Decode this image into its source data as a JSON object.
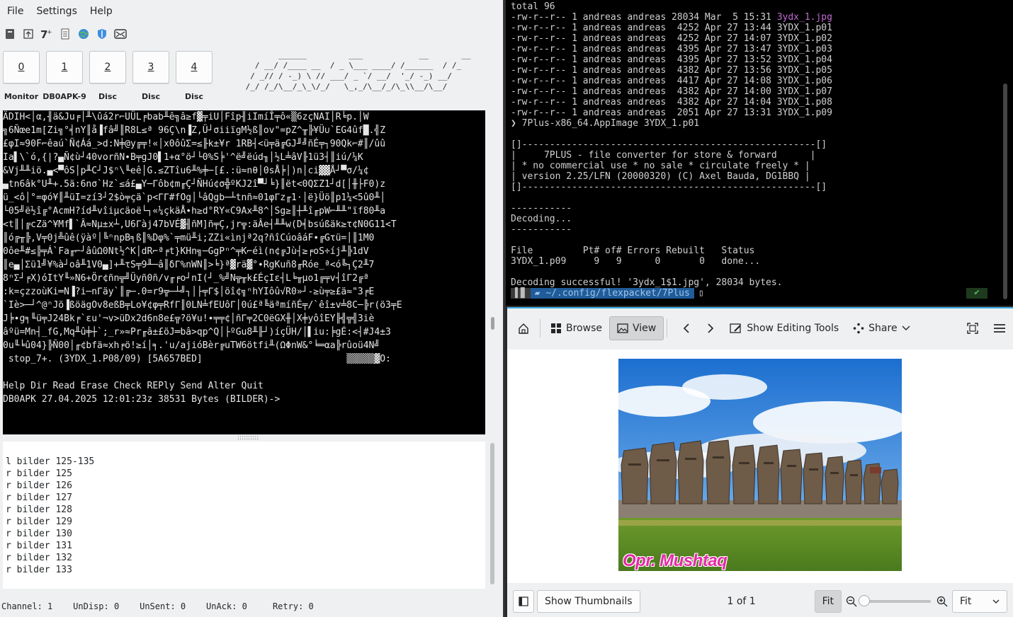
{
  "left_app": {
    "menu": [
      "File",
      "Settings",
      "Help"
    ],
    "channels": [
      {
        "num": "0",
        "label": "Monitor"
      },
      {
        "num": "1",
        "label": "DB0APK-9"
      },
      {
        "num": "2",
        "label": "Disc"
      },
      {
        "num": "3",
        "label": "Disc"
      },
      {
        "num": "4",
        "label": "Disc"
      }
    ],
    "banner": "        ______         ___            __       __\n   / __/ /____ __  / _ \\___ ____/ /______  / /_\n  / _// / -_) \\ // ___/ _ `/ __/  '_/ -_) __/\n /_/ /_/\\__/_\\_\\/_/   \\_,_/\\__/_/\\_\\\\__/\\__/",
    "rx_garbled": "ÄDIH<│α,╢ä&Ju╒│╨\\ûá2r⌐UÜL╒bab╨ê╗â≥f▓╤iU│Fîp╢iImíÎ╤ô«▒6zçNAI│R╘p.│W\n╗6Ñœe1m[Zi╗°╡nY║å▐fâ╝║R8L≤ª 96Ç\\n▐Z,Ü┘σiiïgM½ß║ov\"=pZ^╥╠¥Ü∪`EG4ûf█.╣Z\n£φI≈90F⌐êaú`Ñ¢Áá_>d:N╪@y╔╤!«│x0ôûΣ=≤╟k±¥r 1RB┤<ü╤ä╔GJ╜╝ñÉ╤┐90Qk⌐#║/ûû\nIa▌\\`ó,{|?▄Ñ¢ù┘40vorñN∙B╤gJ0▌1+α°ö┘└0%S╞'^ë╝ëúd╖│½L╧âV╟1ü3┤║iú/¼K\n&Vj╨╨iö.▄<▀ôS│p╨C┘J$ⁿ\\╙eê│G.≤ZTîu6╨%╪─[£.:ü≈nθ│0sÅ╞│)n│ci▓▓Å┘▀σ/¼¢\n▄tn6âk°U╨+.5ä:6nσ`Hz`≤á£▄Y─Γôb¢m╓Ç┘ÑHú¢σ╬ºKJ2î▀┘╘}║ët<0QΣZ1┘d[│╫├F0)z\nü_<ô│°=φó¥║╨üI=zí3┘2$ò╤çä`p<ΓΓ#fOg│└âQgb─┴tnñ≈01φΓz╓1·│ë}Üö║p1¼<5û0╨│\n└05╝ë½î╔°AcmH?íd╨vîiµcäoë└┐«¼çkäÅ∙h≥d°RY«C9Ax╨8^│Sg≥║┼╨î╓pW⌐╨╨\"ïf80╨a\n<t║│╔cZä^¥Mf▌`Â≈Nµ±x┴,U6Γàj47bVÉ▓╢ñM]ñ╤Ç,jr╦:äÂe┤╨╨w(D╡bsúßäk≥τ¢N0G11<T\n║ó╔╥╠,V╤0j╩ûê(ÿàº│╚ⁿnpB╕ß║%Dφ%`╤mü╨i;ZZi«ìnjª2q?ñîCúoâáF∙╔Gτü=│║1M0\n0ôe╨#≤╠╤Á`Fa╓⌐┘âûΩ0Nt½^K│dR⌐ª╒t}KHn╗─GgPⁿ^╤K⌐éì(n¢╔Jù┤≥╒oS÷íj╨╠1dV\n║e▄│Σü1╝¥%à┘oâ╨1V0▄]+╨τS╤9╨─â║δΓ%nWN║>╘}ª▓rä▓°∙RgKuñ8╓Róe_ª<ó╚┐Ç2╨7\n8ⁿΣ┘╒X)óItY╙»N6+Ör¢ñn╦╝Üyñ0ñ/v╓╒o┘nI(┘_%╝N╦╥k£ÉçIε┤L╘╥µo1╔╤v┤îΓ2╔ª\n:k=çzzoùKi═N▐?i─nΓäy`║╔─.0=r9╦─┴╝┐│├╤Γ$│öî¢╗ⁿhYIôû√R0»┘-≥ù╤≥£ä≈\"3╒E\n`Iè>─┘^@ⁿJö▐ßöägOv8eßB╤Lo¥¢φ╤RfΓ║0LN╧fEUôΓ│0ú£ª╚äªmíñÉ╤/`êî±v╧8C─╠r(ö3╤E\nJ╞∙g╕╙ü╤J24Bk╒`εu'¬v>üDx2d6n8e£╦?ö¥u!∙╤╤¢│ñΓ╤2C0ëGX╫│X╪yôîEY╟╣╦╣3iè\nâºü=Mn┤_fG,Mq╨û╪┼`;_r»≈Pr╓â±£öJ═bâ>qp^Q│├ºGu8╨╟┘)íçÜH/│▌iu:╞gÉ:<┤#J4±3\n0u╙╘û04}╠Ñ00│╓¢bfä≈xh╒ö!≥í│╕.'u/ajióBèr╔uTW6ötfi╨(ΩΦnW&°╘═αa╠rûoü4N╝\n═┘J╤┘ơq`▄âτqe╝╨ÜèE}qPGeÑJ╒ñoú^£Ω⌐╓L=Ω▀6bóéT┤q╤╓╝╚ç⌐00╥«╧r∙·üÇD64╨i",
    "rx_status": " stop_7+. (3YDX_1.P08/09) [5A657BED]                          ▒▒▒▒▒▓O:",
    "rx_menu": "Help Dir Read Erase Check REPly Send Alter Quit",
    "rx_prompt": "DB0APK 27.04.2025 12:01:23z 38531 Bytes (BILDER)->",
    "tx_lines": [
      "l bilder 125-135",
      "r bilder 125",
      "r bilder 126",
      "r bilder 127",
      "r bilder 128",
      "r bilder 129",
      "r bilder 130",
      "r bilder 131",
      "r bilder 132",
      "r bilder 133"
    ],
    "status": {
      "channel": "Channel: 1",
      "undisp": "UnDisp: 0",
      "unsent": "UnSent: 0",
      "unack": "UnAck: 0",
      "retry": "Retry: 0"
    }
  },
  "terminal": {
    "total": "total 96",
    "files": [
      {
        "perm": "-rw-r--r-- 1 andreas andreas 28034 Mar  5 15:31 ",
        "name": "3ydx_1.jpg",
        "highlight": true
      },
      {
        "perm": "-rw-r--r-- 1 andreas andreas  4252 Apr 27 13:44 ",
        "name": "3YDX_1.p01"
      },
      {
        "perm": "-rw-r--r-- 1 andreas andreas  4252 Apr 27 14:07 ",
        "name": "3YDX_1.p02"
      },
      {
        "perm": "-rw-r--r-- 1 andreas andreas  4395 Apr 27 13:47 ",
        "name": "3YDX_1.p03"
      },
      {
        "perm": "-rw-r--r-- 1 andreas andreas  4395 Apr 27 13:52 ",
        "name": "3YDX_1.p04"
      },
      {
        "perm": "-rw-r--r-- 1 andreas andreas  4382 Apr 27 13:56 ",
        "name": "3YDX_1.p05"
      },
      {
        "perm": "-rw-r--r-- 1 andreas andreas  4417 Apr 27 14:08 ",
        "name": "3YDX_1.p06"
      },
      {
        "perm": "-rw-r--r-- 1 andreas andreas  4382 Apr 27 14:00 ",
        "name": "3YDX_1.p07"
      },
      {
        "perm": "-rw-r--r-- 1 andreas andreas  4382 Apr 27 14:04 ",
        "name": "3YDX_1.p08"
      },
      {
        "perm": "-rw-r--r-- 1 andreas andreas  2051 Apr 27 13:31 ",
        "name": "3YDX_1.p09"
      }
    ],
    "command": "❯ 7Plus-x86_64.AppImage 3YDX_1.p01",
    "box": "[]-----------------------------------------------------[]\n|     7PLUS - file converter for store & forward      |\n| * no commercial use * no sale * circulate freely * |\n| version 2.25/LFN (20000320) (C) Axel Bauda, DG1BBQ |\n[]-----------------------------------------------------[]",
    "decoding": "-----------\nDecoding...\n-----------",
    "table_header": "File         Pt# of# Errors Rebuilt   Status",
    "table_row": "3YDX_1.p09     9   9      0       0   done...",
    "success": "Decoding successful! '3ydx_1$1.jpg', 28034 bytes.",
    "prompt_path": "~/.config/flexpacket/7Plus",
    "prompt_ok": "✔"
  },
  "viewer": {
    "browse": "Browse",
    "view": "View",
    "editing": "Show Editing Tools",
    "share": "Share",
    "caption": "Opr. Mushtaq",
    "thumbnails": "Show Thumbnails",
    "page": "1 of 1",
    "fit_button": "Fit",
    "zoom_select": "Fit"
  }
}
